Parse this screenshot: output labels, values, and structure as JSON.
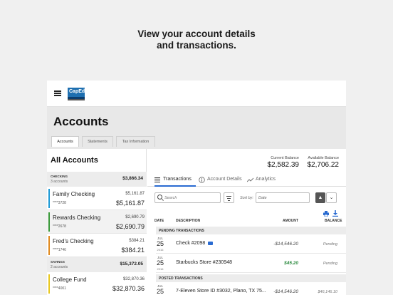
{
  "headline": {
    "line1": "View your account details",
    "line2": "and transactions."
  },
  "app": {
    "logo_text": "CapEd",
    "page_title": "Accounts",
    "tabs": [
      {
        "label": "Accounts",
        "active": true
      },
      {
        "label": "Statements",
        "active": false
      },
      {
        "label": "Tax Information",
        "active": false
      }
    ]
  },
  "sidebar": {
    "heading": "All Accounts",
    "groups": [
      {
        "name": "CHECKING",
        "count": "3 accounts",
        "total": "$3,866.34"
      },
      {
        "name": "SAVINGS",
        "count": "2 accounts",
        "total": "$15,372.05"
      }
    ],
    "accounts": [
      {
        "name": "Family Checking",
        "number": "****3728",
        "current": "$5,161.87",
        "available": "$5,161.87",
        "color": "#1e9ad6"
      },
      {
        "name": "Rewards Checking",
        "number": "****2678",
        "current": "$2,690.79",
        "available": "$2,690.79",
        "color": "#3a9a3a"
      },
      {
        "name": "Fred's Checking",
        "number": "****1746",
        "current": "$384.21",
        "available": "$384.21",
        "color": "#e08a1e"
      },
      {
        "name": "College Fund",
        "number": "****4001",
        "current": "$32,870.36",
        "available": "$32,870.36",
        "color": "#e8c81e"
      }
    ]
  },
  "summary": {
    "current_label": "Current Balance",
    "current_value": "$2,582.39",
    "available_label": "Available Balance",
    "available_value": "$2,706.22"
  },
  "subtabs": [
    {
      "label": "Transactions",
      "icon": "list-icon",
      "active": true
    },
    {
      "label": "Account Details",
      "icon": "info-icon",
      "active": false
    },
    {
      "label": "Analytics",
      "icon": "trend-icon",
      "active": false
    }
  ],
  "toolbar": {
    "search_placeholder": "Search",
    "sort_label": "Sort by:",
    "sort_value": "Date",
    "sort_up": "▲",
    "sort_down": "⌄"
  },
  "table": {
    "columns": [
      "DATE",
      "DESCRIPTION",
      "AMOUNT",
      "BALANCE"
    ],
    "pending_header": "PENDING TRANSACTIONS",
    "posted_header": "POSTED TRANSACTIONS",
    "pending": [
      {
        "mon": "JUL",
        "day": "25",
        "yr": "2016",
        "desc": "Check #2098",
        "amount": "-$14,546.20",
        "balance": "Pending",
        "amount_color": "default"
      },
      {
        "mon": "JUL",
        "day": "25",
        "yr": "2016",
        "desc": "Starbucks Store #230948",
        "amount": "$45.20",
        "balance": "Pending",
        "amount_color": "green"
      }
    ],
    "posted": [
      {
        "mon": "JUL",
        "day": "25",
        "yr": "2016",
        "desc": "7-Eleven Store ID #3032, Plano, TX 75...",
        "amount": "-$14,546.20",
        "balance": "$46,146.10"
      }
    ]
  }
}
